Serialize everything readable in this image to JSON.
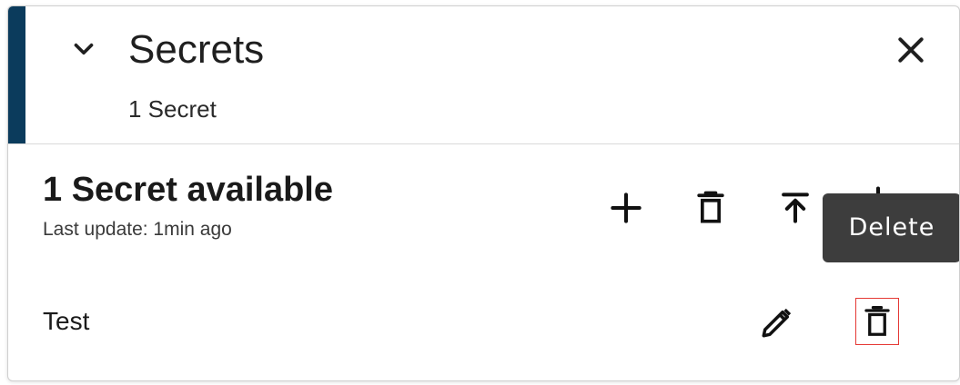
{
  "header": {
    "title": "Secrets",
    "subtitle": "1 Secret",
    "chevron_icon": "chevron-down-icon",
    "close_icon": "close-icon",
    "accent_color": "#0b3b5c"
  },
  "summary": {
    "title": "1 Secret available",
    "last_update": "Last update: 1min ago"
  },
  "toolbar": {
    "icons": [
      "add-icon",
      "delete-icon",
      "upload-icon",
      "download-icon"
    ]
  },
  "tooltip": {
    "text": "Delete"
  },
  "secrets": [
    {
      "name": "Test",
      "actions": [
        "edit-icon",
        "delete-icon"
      ]
    }
  ],
  "highlight_color": "#e53935"
}
